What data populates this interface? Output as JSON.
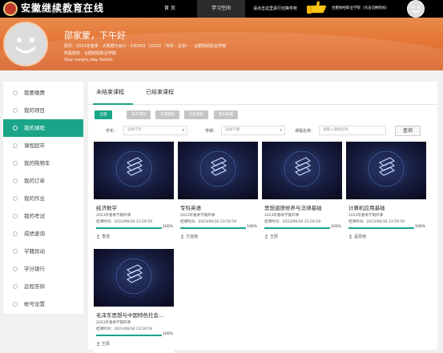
{
  "header": {
    "logo_cn": "安徽继续教育在线",
    "logo_en": "Anhui Continuing Education Online",
    "nav": [
      {
        "label": "首 页"
      },
      {
        "label": "学习空间"
      }
    ],
    "switch_hint": "请点击这里进行切换学校",
    "school_link": "合肥财经职业学院（点击切换院校）"
  },
  "banner": {
    "greeting": "邵家蒙，下午好",
    "line1": "层次：2023年春季 - 大数据与会计 - 530302（2022）（专科 - 业余） - 合肥财经职业学院",
    "line2": "所属院校：合肥财经职业学院",
    "line3": "Stay hungry,stay foolish."
  },
  "sidebar": {
    "items": [
      {
        "label": "我要缴费"
      },
      {
        "label": "我的项目"
      },
      {
        "label": "我的课程",
        "active": true
      },
      {
        "label": "课程超市"
      },
      {
        "label": "我的购物车"
      },
      {
        "label": "我的订单"
      },
      {
        "label": "我的作业"
      },
      {
        "label": "我的考试"
      },
      {
        "label": "成绩查询"
      },
      {
        "label": "学籍异动"
      },
      {
        "label": "学分银行"
      },
      {
        "label": "远程答辩"
      },
      {
        "label": "帐号设置"
      }
    ]
  },
  "tabs": [
    {
      "label": "未结束课程",
      "active": true
    },
    {
      "label": "已结束课程"
    }
  ],
  "chips": [
    {
      "label": "全部",
      "active": true
    },
    {
      "label": "未开课程"
    },
    {
      "label": "开课课程"
    },
    {
      "label": "已结课程"
    },
    {
      "label": "我的收藏"
    }
  ],
  "filters": {
    "year_label": "学年：",
    "year_placeholder": "选择学年",
    "term_label": "学期：",
    "term_placeholder": "选择学期",
    "name_label": "课程名称：",
    "name_placeholder": "请输入课程名称",
    "query_label": "查询"
  },
  "courses": [
    {
      "title": "经济数学",
      "term": "2023年春季学期开课",
      "end": "结课时间：2023/06/30 23:59:59",
      "progress": 100,
      "progress_text": "100%",
      "teacher": "李茂"
    },
    {
      "title": "专科英语",
      "term": "2023年春季学期开课",
      "end": "结课时间：2023/06/30 23:59:59",
      "progress": 100,
      "progress_text": "100%",
      "teacher": "方亚南"
    },
    {
      "title": "思想道德修养与法律基础",
      "term": "2023年春季学期开课",
      "end": "结课时间：2023/06/30 23:59:59",
      "progress": 100,
      "progress_text": "100%",
      "teacher": "王辰"
    },
    {
      "title": "计算机应用基础",
      "term": "2023年春季学期开课",
      "end": "结课时间：2023/06/30 23:59:59",
      "progress": 100,
      "progress_text": "100%",
      "teacher": "孟思雨"
    },
    {
      "title": "毛泽东思想与中国特色社会...",
      "term": "2023年春季学期开课",
      "end": "结课时间：2023/06/30 23:59:59",
      "progress": 100,
      "progress_text": "100%",
      "teacher": "王辰"
    }
  ],
  "colors": {
    "accent": "#1aa589",
    "banner": "#e57637",
    "topbar": "#000000"
  },
  "icons": {
    "hand": "pointing-hand-icon",
    "avatar": "smiley-avatar-icon",
    "teacher": "user-icon",
    "thumb": "layers-logo-icon"
  }
}
